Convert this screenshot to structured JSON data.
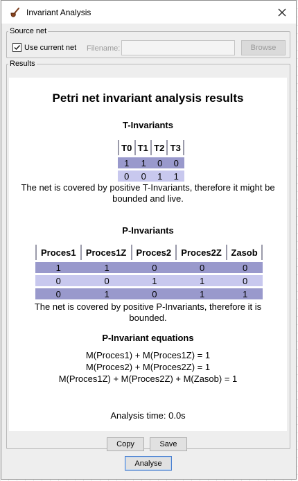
{
  "window": {
    "title": "Invariant Analysis"
  },
  "source": {
    "legend": "Source net",
    "use_current_label": "Use current net",
    "use_current_checked": true,
    "filename_label": "Filename:",
    "filename_value": "",
    "browse_label": "Browse"
  },
  "results": {
    "legend": "Results",
    "title": "Petri net invariant analysis results",
    "t_heading": "T-Invariants",
    "t_columns": [
      "T0",
      "T1",
      "T2",
      "T3"
    ],
    "t_rows": [
      [
        "1",
        "1",
        "0",
        "0"
      ],
      [
        "0",
        "0",
        "1",
        "1"
      ]
    ],
    "t_summary": "The net is covered by positive T-Invariants, therefore it might be bounded and live.",
    "p_heading": "P-Invariants",
    "p_columns": [
      "Proces1",
      "Proces1Z",
      "Proces2",
      "Proces2Z",
      "Zasob"
    ],
    "p_rows": [
      [
        "1",
        "1",
        "0",
        "0",
        "0"
      ],
      [
        "0",
        "0",
        "1",
        "1",
        "0"
      ],
      [
        "0",
        "1",
        "0",
        "1",
        "1"
      ]
    ],
    "p_summary": "The net is covered by positive P-Invariants, therefore it is bounded.",
    "eq_heading": "P-Invariant equations",
    "equations": [
      "M(Proces1) + M(Proces1Z) = 1",
      "M(Proces2) + M(Proces2Z) = 1",
      "M(Proces1Z) + M(Proces2Z) + M(Zasob) = 1"
    ],
    "time_text": "Analysis time: 0.0s"
  },
  "buttons": {
    "copy": "Copy",
    "save": "Save",
    "analyse": "Analyse"
  },
  "colors": {
    "row_dark": "#9999cc",
    "row_light": "#c8c8ee",
    "focus_border": "#4a80d0"
  },
  "icons": {
    "app": "pipe-icon",
    "close": "close-icon",
    "check": "checkmark-icon"
  }
}
